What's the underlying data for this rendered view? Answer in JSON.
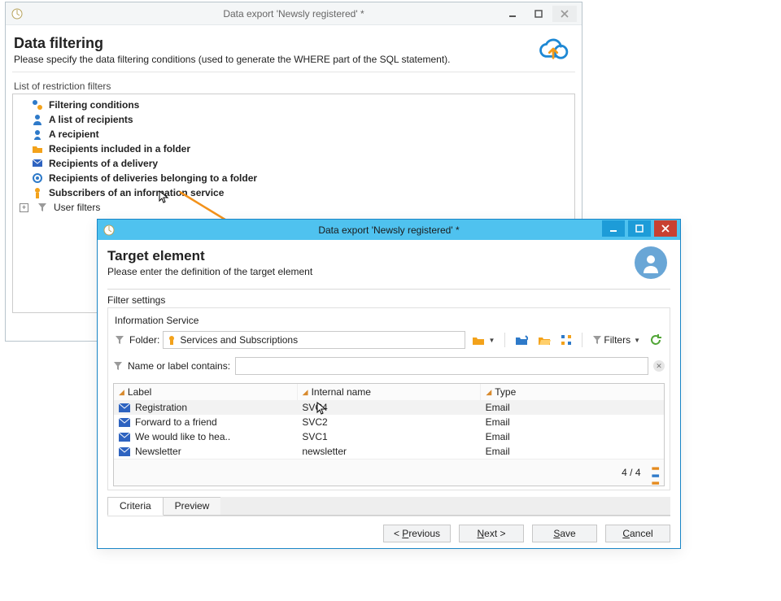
{
  "back_window": {
    "title": "Data export 'Newsly registered' *",
    "heading": "Data filtering",
    "subtitle": "Please specify the data filtering conditions (used to generate the WHERE part of the SQL statement).",
    "group_label": "List of restriction filters",
    "filters": [
      {
        "label": "Filtering conditions"
      },
      {
        "label": "A list of recipients"
      },
      {
        "label": "A recipient"
      },
      {
        "label": "Recipients included in a folder"
      },
      {
        "label": "Recipients of a delivery"
      },
      {
        "label": "Recipients of deliveries belonging to a folder"
      },
      {
        "label": "Subscribers of an information service"
      }
    ],
    "user_filters_label": "User filters"
  },
  "front_window": {
    "title": "Data export 'Newsly registered' *",
    "heading": "Target element",
    "subtitle": "Please enter the definition of the target element",
    "filter_settings_label": "Filter settings",
    "info_service_label": "Information Service",
    "folder_label": "Folder:",
    "folder_value": "Services and Subscriptions",
    "filters_btn": "Filters",
    "name_label": "Name or label contains:",
    "name_value": "",
    "columns": {
      "label": "Label",
      "internal": "Internal name",
      "type": "Type"
    },
    "rows": [
      {
        "label": "Registration",
        "internal": "SVC4",
        "type": "Email",
        "selected": true
      },
      {
        "label": "Forward to a friend",
        "internal": "SVC2",
        "type": "Email"
      },
      {
        "label": "We would like to hea..",
        "internal": "SVC1",
        "type": "Email"
      },
      {
        "label": "Newsletter",
        "internal": "newsletter",
        "type": "Email"
      }
    ],
    "count": "4 / 4",
    "tabs": {
      "criteria": "Criteria",
      "preview": "Preview"
    },
    "buttons": {
      "prev": "< Previous",
      "next": "Next >",
      "save": "Save",
      "cancel": "Cancel"
    },
    "buttons_accel": {
      "prev_u": "P",
      "next_u": "N",
      "save_u": "S",
      "cancel_u": "C"
    }
  }
}
